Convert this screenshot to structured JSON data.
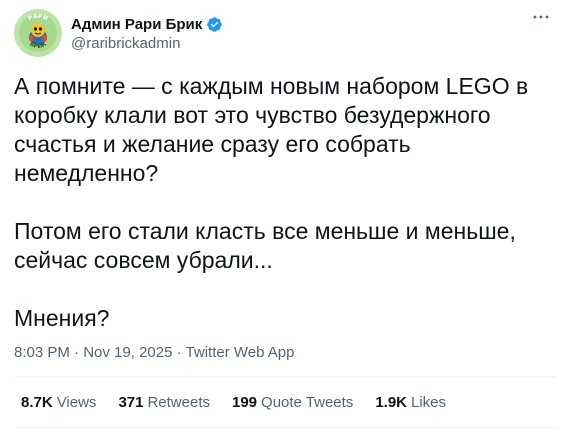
{
  "author": {
    "display_name": "Админ Рари Брик",
    "handle": "@raribrickadmin",
    "verified": true,
    "avatar_text_top": "РАРИ",
    "avatar_text_bottom": "БРИК",
    "avatar_bg": "#bde3a8"
  },
  "tweet": {
    "paragraphs": [
      "А помните — с каждым новым набором LEGO в коробку клали вот это чувство безудержного счастья и желание сразу его собрать немедленно?",
      "Потом его стали класть все меньше и меньше, сейчас совсем убрали...",
      "Мнения?"
    ],
    "time": "8:03 PM",
    "date": "Nov 19, 2025",
    "source": "Twitter Web App"
  },
  "stats": {
    "views_num": "8.7K",
    "views_label": "Views",
    "retweets_num": "371",
    "retweets_label": "Retweets",
    "quotes_num": "199",
    "quotes_label": "Quote Tweets",
    "likes_num": "1.9K",
    "likes_label": "Likes"
  },
  "colors": {
    "verified": "#1d9bf0",
    "secondary_text": "#536471",
    "primary_text": "#0f1419"
  },
  "icons": {
    "more": "more-horizontal-icon",
    "verified": "verified-badge-icon"
  }
}
